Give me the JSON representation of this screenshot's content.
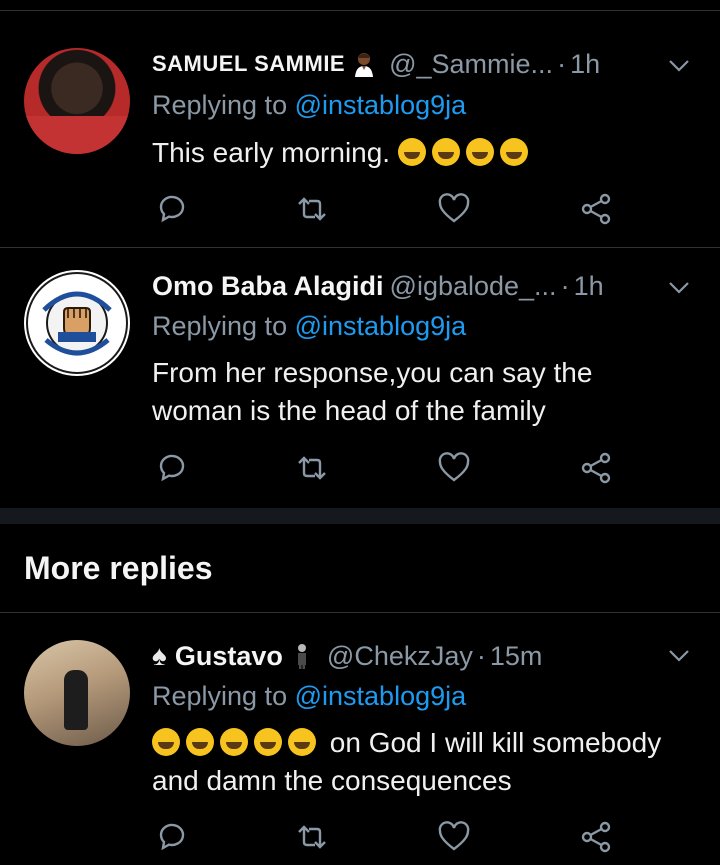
{
  "tweets": [
    {
      "name": "SAMUEL SAMMIE",
      "handle": "@_Sammie...",
      "time": "1h",
      "replying_prefix": "Replying to",
      "mention": "@instablog9ja",
      "text": "This early morning.",
      "emoji": "rolling-on-floor-laughing x4"
    },
    {
      "name": "Omo Baba Alagidi",
      "handle": "@igbalode_...",
      "time": "1h",
      "replying_prefix": "Replying to",
      "mention": "@instablog9ja",
      "text": "From her response,you can say the woman is the head of the family",
      "logo_text": [
        "STINGY MEN ASSOCIATION OF NIGERIA",
        "SMAN",
        "DON'T GIVE SHI SHI"
      ]
    },
    {
      "name": "Gustavo",
      "handle": "@ChekzJay",
      "time": "15m",
      "replying_prefix": "Replying to",
      "mention": "@instablog9ja",
      "text": "on God I will kill somebody and damn the consequences",
      "emoji": "grinning-squinting x5"
    }
  ],
  "section": {
    "more_replies": "More replies"
  },
  "colors": {
    "background": "#000000",
    "accent": "#1d9bf0",
    "muted": "#8b98a5"
  },
  "icons": [
    "reply-icon",
    "retweet-icon",
    "like-icon",
    "share-icon",
    "chevron-down-icon"
  ]
}
